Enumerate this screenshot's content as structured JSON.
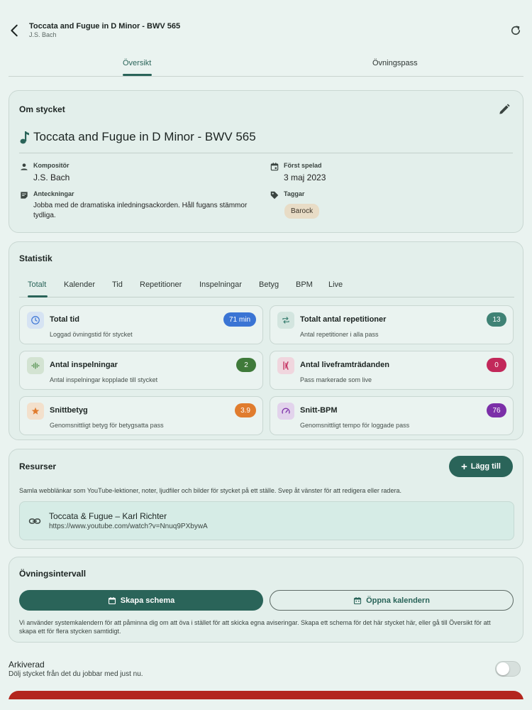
{
  "header": {
    "title": "Toccata and Fugue in D Minor - BWV 565",
    "subtitle": "J.S. Bach",
    "back_icon": "arrow-back-icon",
    "refresh_icon": "refresh-icon"
  },
  "tabs": [
    {
      "label": "Översikt",
      "active": true
    },
    {
      "label": "Övningspass",
      "active": false
    }
  ],
  "about": {
    "section_title": "Om stycket",
    "piece_title": "Toccata and Fugue in D Minor - BWV 565",
    "composer_label": "Kompositör",
    "composer_value": "J.S. Bach",
    "first_played_label": "Först spelad",
    "first_played_value": "3 maj 2023",
    "notes_label": "Anteckningar",
    "notes_value": "Jobba med de dramatiska inledningsackorden. Håll fugans stämmor tydliga.",
    "tags_label": "Taggar",
    "tags": [
      "Barock"
    ]
  },
  "stats": {
    "section_title": "Statistik",
    "tabs": [
      "Totalt",
      "Kalender",
      "Tid",
      "Repetitioner",
      "Inspelningar",
      "Betyg",
      "BPM",
      "Live"
    ],
    "active_tab": "Totalt",
    "cards": [
      {
        "title": "Total tid",
        "desc": "Loggad övningstid för stycket",
        "badge": "71 min",
        "badge_color": "#3a74d4",
        "icon": "clock-icon"
      },
      {
        "title": "Totalt antal repetitioner",
        "desc": "Antal repetitioner i alla pass",
        "badge": "13",
        "badge_color": "#3f8275",
        "icon": "repeat-icon"
      },
      {
        "title": "Antal inspelningar",
        "desc": "Antal inspelningar kopplade till stycket",
        "badge": "2",
        "badge_color": "#3f7a3a",
        "icon": "waveform-icon"
      },
      {
        "title": "Antal liveframträdanden",
        "desc": "Pass markerade som live",
        "badge": "0",
        "badge_color": "#c2285a",
        "icon": "live-performance-icon"
      },
      {
        "title": "Snittbetyg",
        "desc": "Genomsnittligt betyg för betygsatta pass",
        "badge": "3.9",
        "badge_color": "#e07c2e",
        "icon": "star-icon"
      },
      {
        "title": "Snitt-BPM",
        "desc": "Genomsnittligt tempo för loggade pass",
        "badge": "76",
        "badge_color": "#7b2fa8",
        "icon": "speedometer-icon"
      }
    ]
  },
  "resources": {
    "section_title": "Resurser",
    "add_label": "Lägg till",
    "description": "Samla webblänkar som YouTube-lektioner, noter, ljudfiler och bilder för stycket på ett ställe. Svep åt vänster för att redigera eller radera.",
    "items": [
      {
        "title": "Toccata & Fugue – Karl Richter",
        "url": "https://www.youtube.com/watch?v=Nnuq9PXbywA"
      }
    ]
  },
  "interval": {
    "section_title": "Övningsintervall",
    "create_label": "Skapa schema",
    "open_label": "Öppna kalendern",
    "note": "Vi använder systemkalendern för att påminna dig om att öva i stället för att skicka egna aviseringar. Skapa ett schema för det här stycket här, eller gå till Översikt för att skapa ett för flera stycken samtidigt."
  },
  "archive": {
    "label": "Arkiverad",
    "sub": "Dölj stycket från det du jobbar med just nu.",
    "enabled": false
  },
  "colors": {
    "accent": "#2a6459",
    "background": "#eaf3f0",
    "danger": "#b3261e"
  }
}
